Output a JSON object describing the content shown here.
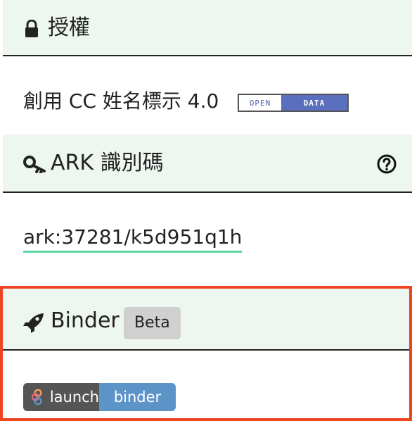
{
  "license": {
    "title": "授權",
    "icon": "lock-icon",
    "text": "創用 CC 姓名標示 4.0",
    "badge_left": "OPEN",
    "badge_right": "DATA"
  },
  "ark": {
    "title": "ARK 識別碼",
    "icon": "key-icon",
    "help_icon": "question-circle-icon",
    "value": "ark:37281/k5d951q1h",
    "underline_color": "#58d6a0"
  },
  "binder": {
    "title": "Binder",
    "icon": "rocket-icon",
    "beta_label": "Beta",
    "launch_left": "launch",
    "launch_right": "binder",
    "highlight_color": "#ee4422"
  }
}
